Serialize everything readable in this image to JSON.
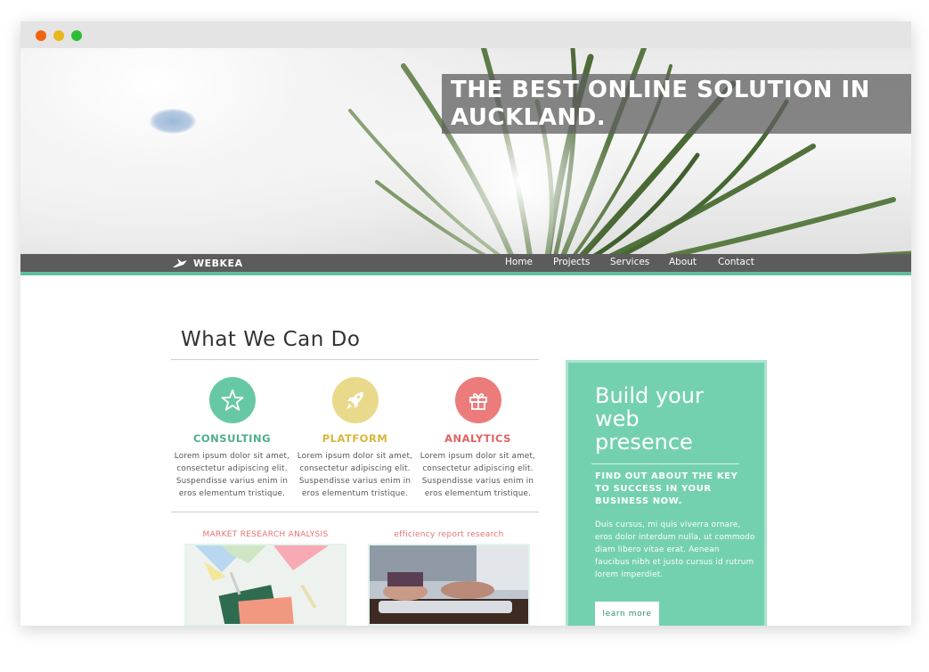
{
  "hero": {
    "headline": "THE BEST ONLINE SOLUTION IN AUCKLAND."
  },
  "nav": {
    "brand": "WEBKEA",
    "items": [
      "Home",
      "Projects",
      "Services",
      "About",
      "Contact"
    ]
  },
  "section": {
    "title": "What We Can Do"
  },
  "services": [
    {
      "title": "CONSULTING",
      "icon": "star-icon",
      "color": "#67c9a4",
      "title_color": "#4fae8a",
      "body": "Lorem ipsum dolor sit amet, consectetur adipiscing elit. Suspendisse varius enim in eros elementum tristique."
    },
    {
      "title": "PLATFORM",
      "icon": "rocket-icon",
      "color": "#e9d98a",
      "title_color": "#d6b73c",
      "body": "Lorem ipsum dolor sit amet, consectetur adipiscing elit. Suspendisse varius enim in eros elementum tristique."
    },
    {
      "title": "ANALYTICS",
      "icon": "gift-icon",
      "color": "#ec7c7c",
      "title_color": "#e06464",
      "body": "Lorem ipsum dolor sit amet, consectetur adipiscing elit. Suspendisse varius enim in eros elementum tristique."
    }
  ],
  "projects": [
    {
      "label": "MARKET RESEARCH ANALYSIS"
    },
    {
      "label": "efficiency report research"
    }
  ],
  "cta": {
    "title": "Build your web presence",
    "subtitle": "FIND OUT ABOUT THE KEY TO SUCCESS IN YOUR BUSINESS NOW.",
    "body": "Duis cursus, mi quis viverra ornare, eros dolor interdum nulla, ut commodo diam libero vitae erat. Aenean faucibus nibh et justo cursus id rutrum lorem imperdiet.",
    "button": "learn more"
  },
  "colors": {
    "accent": "#74d1b0",
    "navbar": "#5c5c5c"
  }
}
